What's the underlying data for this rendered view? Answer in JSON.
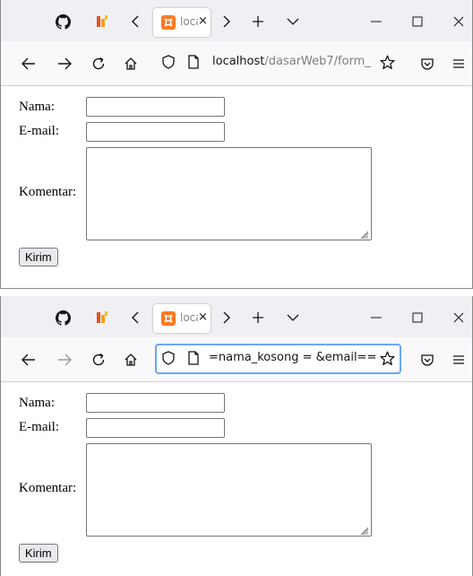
{
  "browser": {
    "tab_title": "loca",
    "tab_close": "×",
    "icons": {
      "github": "github-icon",
      "extension": "extension-icon",
      "back_tabs": "chevron-left-icon",
      "forward_tabs": "chevron-right-icon",
      "new_tab": "plus-icon",
      "list_tabs": "chevron-down-icon",
      "minimize": "minimize-icon",
      "maximize": "maximize-icon",
      "close": "close-icon"
    },
    "colors": {
      "tabbar": "#f0f0f4",
      "navbar": "#f9f9fb",
      "focus_ring": "#6aa6f7",
      "xampp_orange": "#fb7a24"
    }
  },
  "window1": {
    "url_host": "localhost",
    "url_path": "/dasarWeb7/form_"
  },
  "window2": {
    "url_text": "=nama_kosong = &email=="
  },
  "form": {
    "nama_label": "Nama:",
    "email_label": "E-mail:",
    "komentar_label": "Komentar:",
    "submit_label": "Kirim"
  }
}
